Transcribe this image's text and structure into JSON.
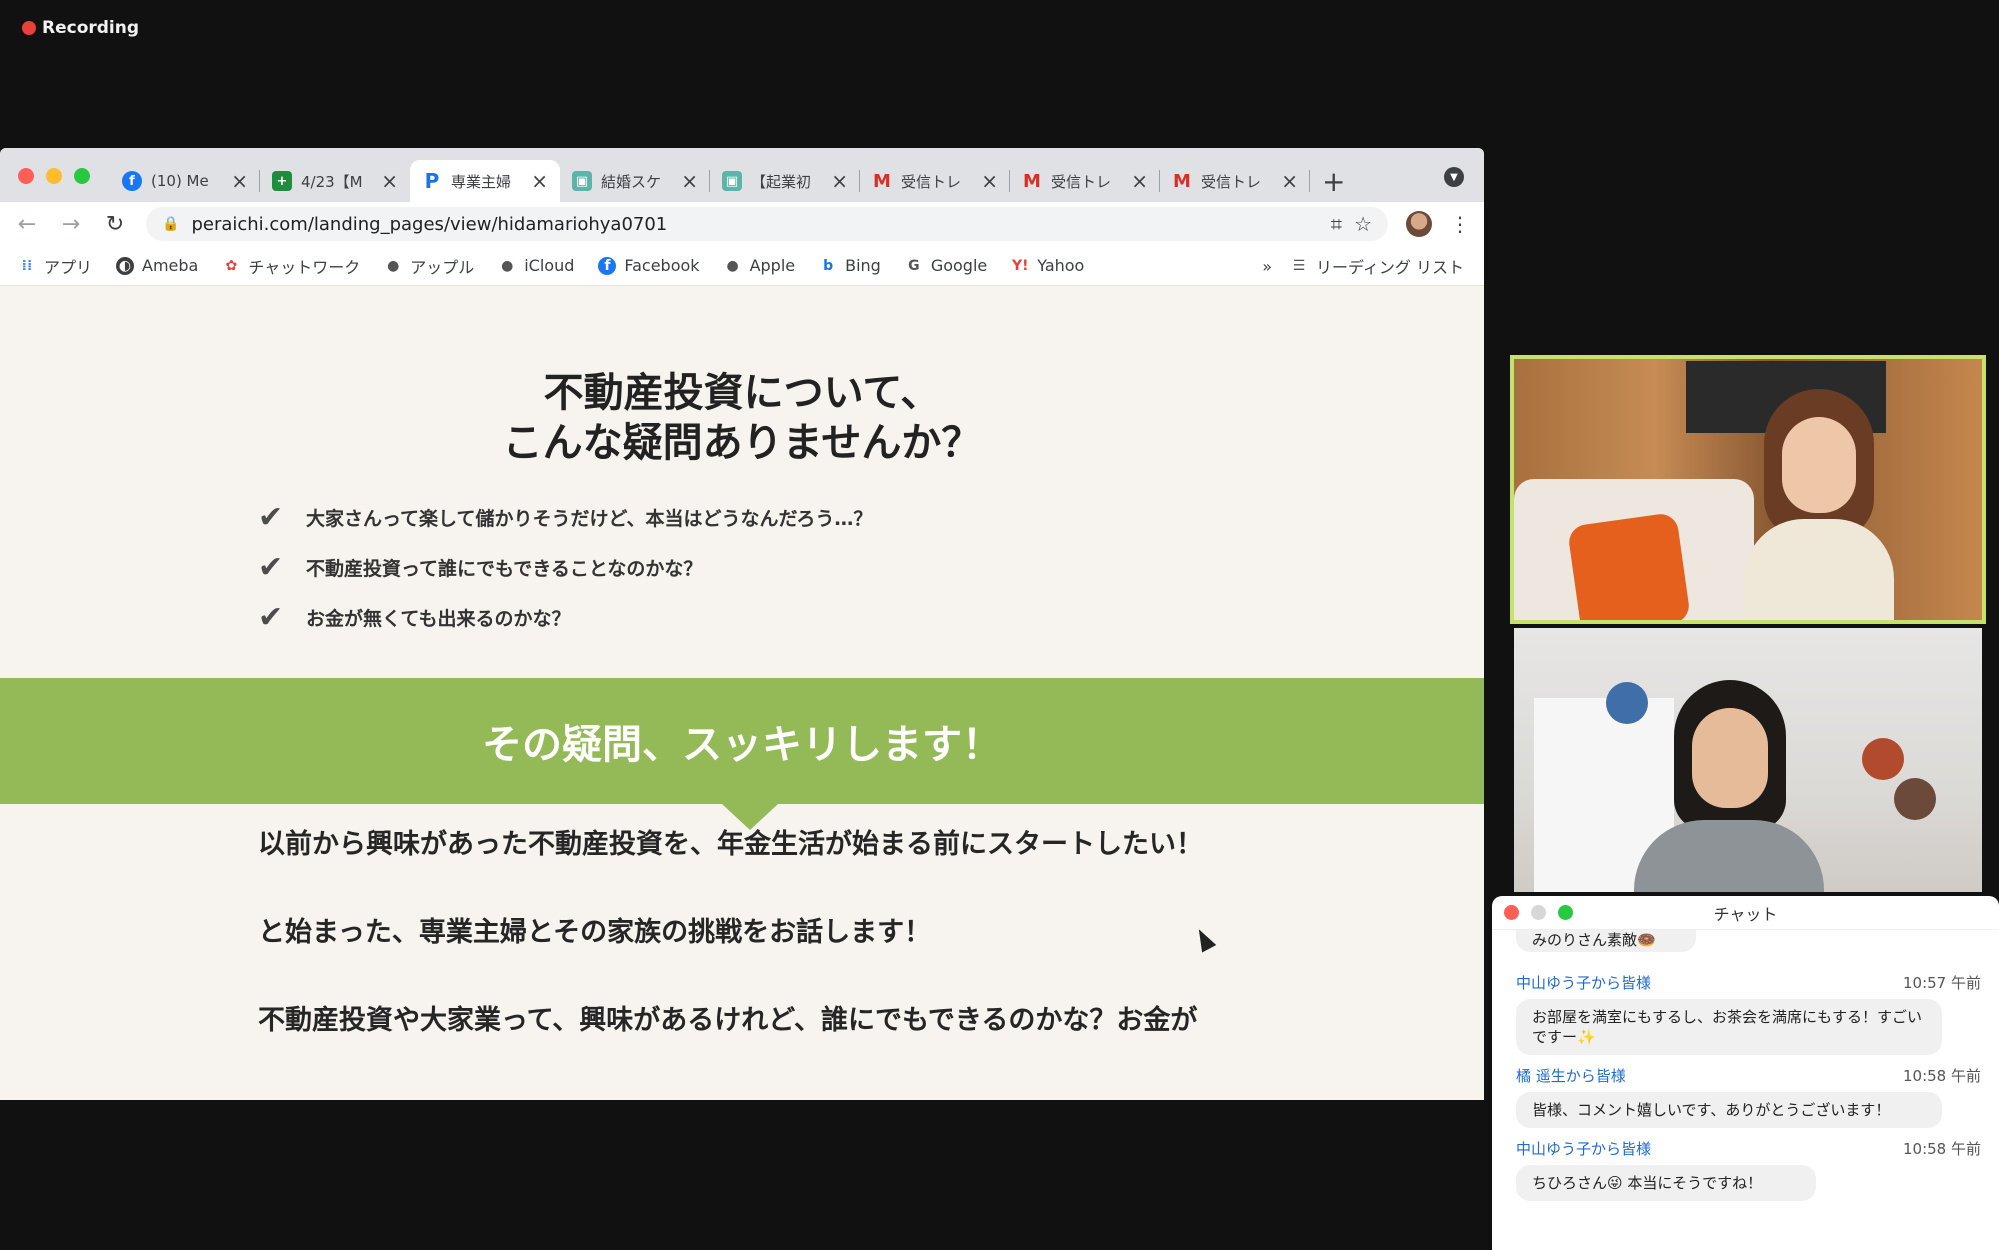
{
  "recording": {
    "label": "Recording"
  },
  "browser": {
    "tabs": [
      {
        "icon": "facebook-icon",
        "label": "(10) Me",
        "active": false
      },
      {
        "icon": "sheets-icon",
        "label": "4/23【M",
        "active": false
      },
      {
        "icon": "peraichi-icon",
        "label": "専業主婦",
        "active": true
      },
      {
        "icon": "doc-icon",
        "label": "結婚スケ",
        "active": false
      },
      {
        "icon": "doc-icon",
        "label": "【起業初",
        "active": false
      },
      {
        "icon": "gmail-icon",
        "label": "受信トレ",
        "active": false
      },
      {
        "icon": "gmail-icon",
        "label": "受信トレ",
        "active": false
      },
      {
        "icon": "gmail-icon",
        "label": "受信トレ",
        "active": false
      }
    ],
    "address": "peraichi.com/landing_pages/view/hidamariohya0701",
    "bookmarks": [
      {
        "icon": "apps-grid-icon",
        "label": "アプリ"
      },
      {
        "icon": "ameba-icon",
        "label": "Ameba"
      },
      {
        "icon": "chatwork-icon",
        "label": "チャットワーク"
      },
      {
        "icon": "apple-icon",
        "label": "アップル"
      },
      {
        "icon": "apple-icon",
        "label": "iCloud"
      },
      {
        "icon": "facebook-icon",
        "label": "Facebook"
      },
      {
        "icon": "apple-icon",
        "label": "Apple"
      },
      {
        "icon": "bing-icon",
        "label": "Bing"
      },
      {
        "icon": "google-icon",
        "label": "Google"
      },
      {
        "icon": "yahoo-icon",
        "label": "Yahoo"
      }
    ],
    "overflow_label": "»",
    "reading_list_label": "リーディング リスト"
  },
  "page": {
    "title_line1": "不動産投資について、",
    "title_line2": "こんな疑問ありませんか？",
    "checks": [
      "大家さんって楽して儲かりそうだけど、本当はどうなんだろう…？",
      "不動産投資って誰にでもできることなのかな？",
      "お金が無くても出来るのかな？"
    ],
    "banner": "その疑問、スッキリします！",
    "paragraphs": [
      "以前から興味があった不動産投資を、年金生活が始まる前にスタートしたい！",
      "と始まった、専業主婦とその家族の挑戦をお話します！",
      "不動産投資や大家業って、興味があるけれど、誰にでもできるのかな？お金が"
    ]
  },
  "chat": {
    "title": "チャット",
    "truncated_message": "みのりさん素敵🍩",
    "messages": [
      {
        "sender": "中山ゆう子から皆様",
        "time": "10:57 午前",
        "text": "お部屋を満室にもするし、お茶会を満席にもする！すごいですー✨"
      },
      {
        "sender": "橘 遥生から皆様",
        "time": "10:58 午前",
        "text": "皆様、コメント嬉しいです、ありがとうございます！"
      },
      {
        "sender": "中山ゆう子から皆様",
        "time": "10:58 午前",
        "text": "ちひろさん😜 本当にそうですね！"
      }
    ]
  },
  "colors": {
    "accent_green": "#94b957",
    "speaker_border": "#c5e26a",
    "sender_blue": "#1f6cd1",
    "recording_red": "#e8413b"
  }
}
